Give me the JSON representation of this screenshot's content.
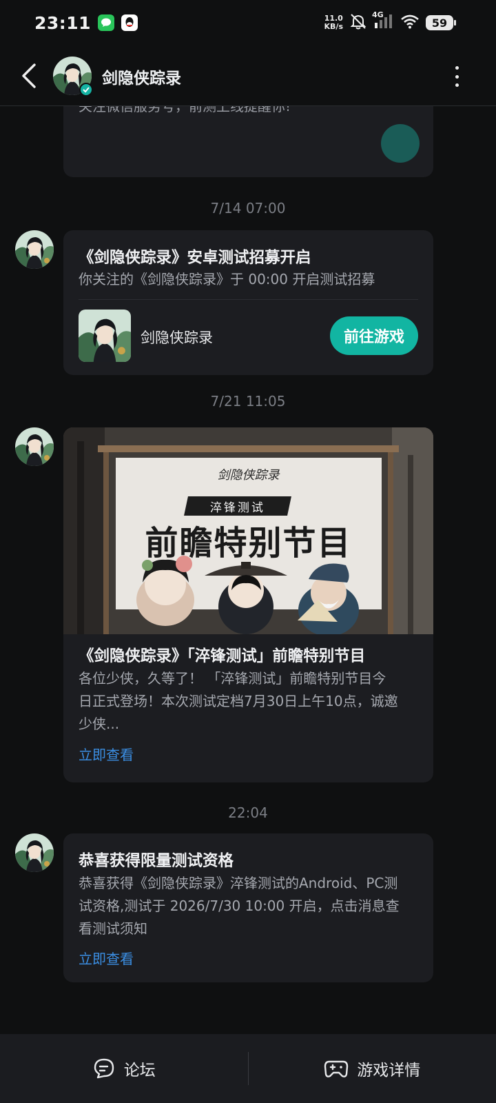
{
  "status_bar": {
    "time": "23:11",
    "net_speed_value": "11.0",
    "net_speed_unit": "KB/s",
    "network": "4G",
    "battery": "59"
  },
  "header": {
    "title": "剑隐侠踪录"
  },
  "messages": [
    {
      "body_fragment": "关注微信服务号，前测上线提醒你!"
    },
    {
      "timestamp": "7/14  07:00",
      "title": "《剑隐侠踪录》安卓测试招募开启",
      "body": "你关注的《剑隐侠踪录》于 00:00 开启测试招募",
      "game_name": "剑隐侠踪录",
      "button": "前往游戏"
    },
    {
      "timestamp": "7/21  11:05",
      "banner_logo": "剑隐侠踪录",
      "banner_tag": "淬锋测试",
      "banner_title": "前瞻特别节目",
      "title": "《剑隐侠踪录》「淬锋测试」前瞻特别节目",
      "body_line1": "各位少侠，久等了！ 「淬锋测试」前瞻特别节目今",
      "body_line2": "日正式登场！本次测试定档7月30日上午10点，诚邀",
      "body_line3": "少侠...",
      "link": "立即查看"
    },
    {
      "timestamp": "22:04",
      "title": "恭喜获得限量测试资格",
      "body_line1": "恭喜获得《剑隐侠踪录》淬锋测试的Android、PC测",
      "body_line2": "试资格,测试于 2026/7/30 10:00 开启，点击消息查",
      "body_line3": "看测试须知",
      "link": "立即查看"
    }
  ],
  "bottom_bar": {
    "forum": "论坛",
    "game_details": "游戏详情"
  },
  "colors": {
    "background": "#0f1011",
    "card": "#1c1d21",
    "accent_teal": "#12b5a2",
    "link_blue": "#3b8fe4"
  }
}
